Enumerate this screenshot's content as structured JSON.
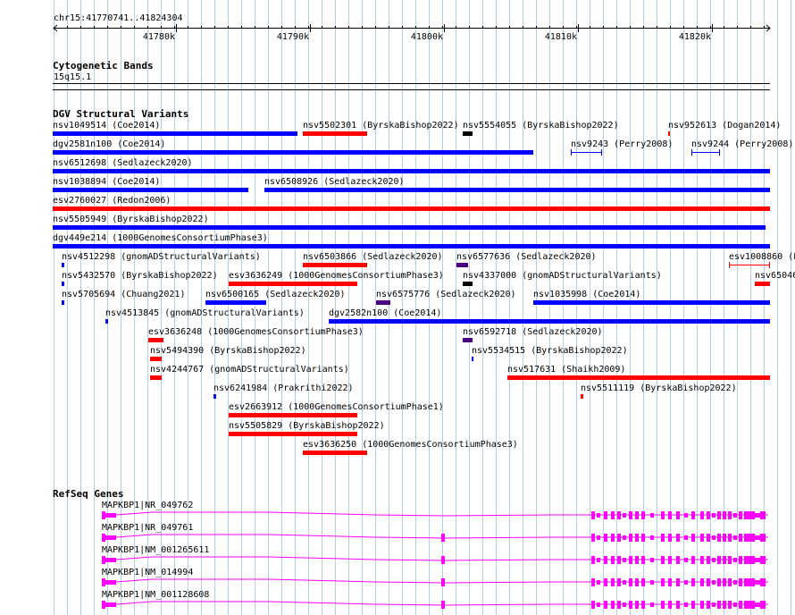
{
  "location": "chr15:41770741..41824304",
  "ruler_ticks": [
    "41780k",
    "41790k",
    "41800k",
    "41810k",
    "41820k"
  ],
  "colors": {
    "grid": "#b3cde8",
    "loss": "#0000ff",
    "gain": "#ff0000",
    "complex": "#4b0082",
    "other": "#000000",
    "gene": "#ff00ff"
  },
  "tracks": {
    "cytoband": {
      "title": "Cytogenetic Bands",
      "band": "15q15.1"
    },
    "dgv": {
      "title": "DGV Structural Variants"
    },
    "refseq": {
      "title": "RefSeq Genes"
    }
  },
  "variants": [
    {
      "label": "nsv1049514 (Coe2014)",
      "type": "loss"
    },
    {
      "label": "nsv5502301 (ByrskaBishop2022)",
      "type": "gain"
    },
    {
      "label": "nsv5554055 (ByrskaBishop2022)",
      "type": "other"
    },
    {
      "label": "nsv952613 (Dogan2014)",
      "type": "gain"
    },
    {
      "label": "dgv2581n100 (Coe2014)",
      "type": "loss"
    },
    {
      "label": "nsv9243 (Perry2008)",
      "type": "loss"
    },
    {
      "label": "nsv9244 (Perry2008)",
      "type": "loss"
    },
    {
      "label": "nsv6512698 (Sedlazeck2020)",
      "type": "loss"
    },
    {
      "label": "nsv1038894 (Coe2014)",
      "type": "loss"
    },
    {
      "label": "nsv6508926 (Sedlazeck2020)",
      "type": "loss"
    },
    {
      "label": "esv2760027 (Redon2006)",
      "type": "gain"
    },
    {
      "label": "nsv5505949 (ByrskaBishop2022)",
      "type": "loss"
    },
    {
      "label": "dgv449e214 (1000GenomesConsortiumPhase3)",
      "type": "loss"
    },
    {
      "label": "nsv4512298 (gnomADStructuralVariants)",
      "type": "loss"
    },
    {
      "label": "nsv6503866 (Sedlazeck2020)",
      "type": "gain"
    },
    {
      "label": "nsv6577636 (Sedlazeck2020)",
      "type": "complex"
    },
    {
      "label": "esv1008860 (P",
      "type": "gain"
    },
    {
      "label": "nsv5432570 (ByrskaBishop2022)",
      "type": "loss"
    },
    {
      "label": "esv3636249 (1000GenomesConsortiumPhase3)",
      "type": "gain"
    },
    {
      "label": "nsv4337000 (gnomADStructuralVariants)",
      "type": "other"
    },
    {
      "label": "nsv65046",
      "type": "gain"
    },
    {
      "label": "nsv5705694 (Chuang2021)",
      "type": "loss"
    },
    {
      "label": "nsv6500165 (Sedlazeck2020)",
      "type": "loss"
    },
    {
      "label": "nsv6575776 (Sedlazeck2020)",
      "type": "complex"
    },
    {
      "label": "nsv1035998 (Coe2014)",
      "type": "loss"
    },
    {
      "label": "nsv4513845 (gnomADStructuralVariants)",
      "type": "loss"
    },
    {
      "label": "dgv2582n100 (Coe2014)",
      "type": "loss"
    },
    {
      "label": "esv3636248 (1000GenomesConsortiumPhase3)",
      "type": "gain"
    },
    {
      "label": "nsv6592718 (Sedlazeck2020)",
      "type": "complex"
    },
    {
      "label": "nsv5494390 (ByrskaBishop2022)",
      "type": "gain"
    },
    {
      "label": "nsv5534515 (ByrskaBishop2022)",
      "type": "loss"
    },
    {
      "label": "nsv4244767 (gnomADStructuralVariants)",
      "type": "gain"
    },
    {
      "label": "nsv517631 (Shaikh2009)",
      "type": "gain"
    },
    {
      "label": "nsv6241984 (Prakrithi2022)",
      "type": "loss"
    },
    {
      "label": "nsv5511119 (ByrskaBishop2022)",
      "type": "gain"
    },
    {
      "label": "esv2663912 (1000GenomesConsortiumPhase1)",
      "type": "gain"
    },
    {
      "label": "nsv5505829 (ByrskaBishop2022)",
      "type": "gain"
    },
    {
      "label": "esv3636250 (1000GenomesConsortiumPhase3)",
      "type": "gain"
    }
  ],
  "genes": [
    {
      "label": "MAPKBP1|NR_049762"
    },
    {
      "label": "MAPKBP1|NR_049761"
    },
    {
      "label": "MAPKBP1|NM_001265611"
    },
    {
      "label": "MAPKBP1|NM_014994"
    },
    {
      "label": "MAPKBP1|NM_001128608"
    }
  ]
}
